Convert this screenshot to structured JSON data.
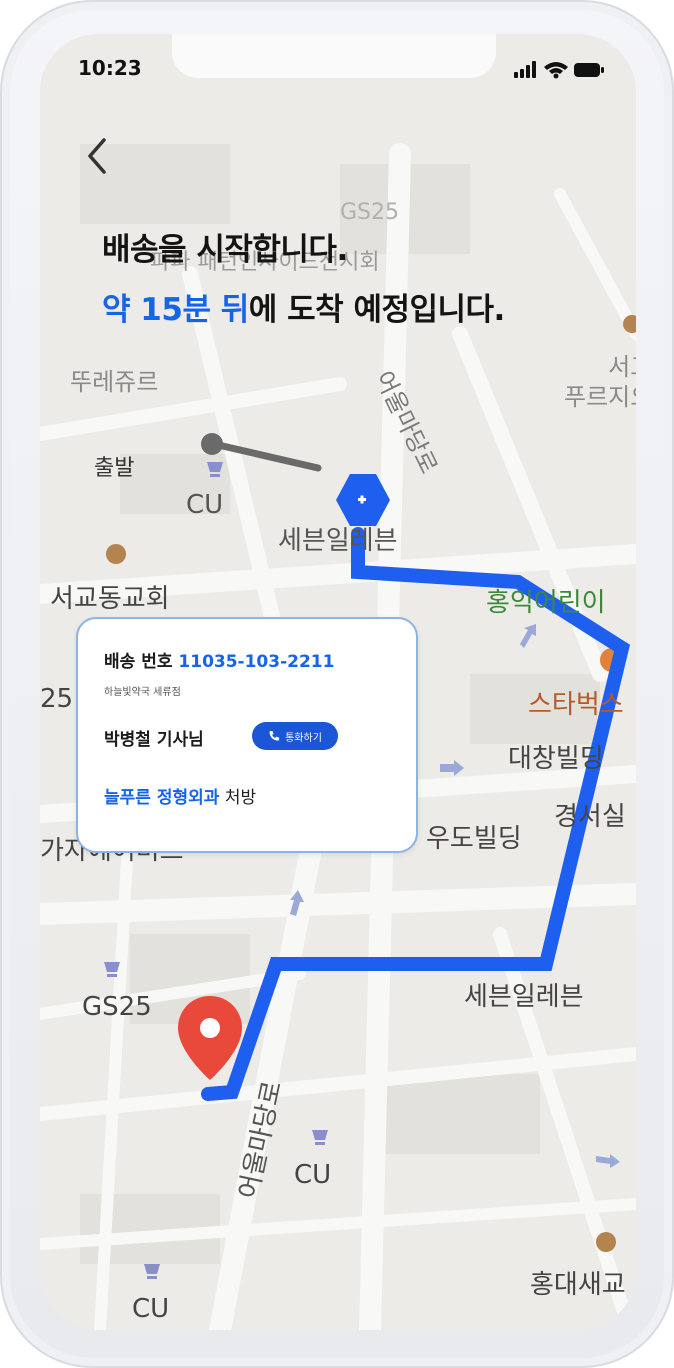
{
  "status_bar": {
    "time": "10:23"
  },
  "header": {
    "title_line1": "배송을 시작합니다.",
    "title_line2_highlight": "약 15분 뒤",
    "title_line2_rest": "에 도착 예정입니다."
  },
  "delivery_card": {
    "number_label": "배송 번호",
    "number_value": "11035-103-2211",
    "pharmacy": "하늘빛약국 세류점",
    "driver": "박병철 기사님",
    "call_label": "통화하기",
    "hospital": "늘푸른 정형외과",
    "prescription_suffix": "처방"
  },
  "map": {
    "start_label": "출발",
    "labels": {
      "cu_top": "CU",
      "seven_eleven_top": "세븐일레븐",
      "seogyo_church": "서교동교회",
      "ttureju": "뚜레쥬르",
      "eoulmadang_road_top": "어울마당로",
      "seogyo_prugio": "서교\n푸르지오",
      "kindergarten": "홍익어린이",
      "starbucks": "스타벅스",
      "daechang": "대창빌딩",
      "gyeongseo": "경서실",
      "udo": "우도빌딩",
      "gaja": "가자에어비즈",
      "seven_eleven_bottom": "세븐일레븐",
      "gs25_left": "GS25",
      "eoulmadang_road_bottom": "어울마당로",
      "cu_mid": "CU",
      "cu_bottom": "CU",
      "hongdae": "홍대새교",
      "partial_25": "25",
      "partial_gs25_top": "GS25",
      "partial_exhibit": "파파 패턴인사이드전시회"
    },
    "colors": {
      "route": "#1f5ff0",
      "start_route": "#6a6a6a",
      "destination_pin": "#e8493a",
      "pharmacy_marker": "#1f5ff0"
    }
  }
}
